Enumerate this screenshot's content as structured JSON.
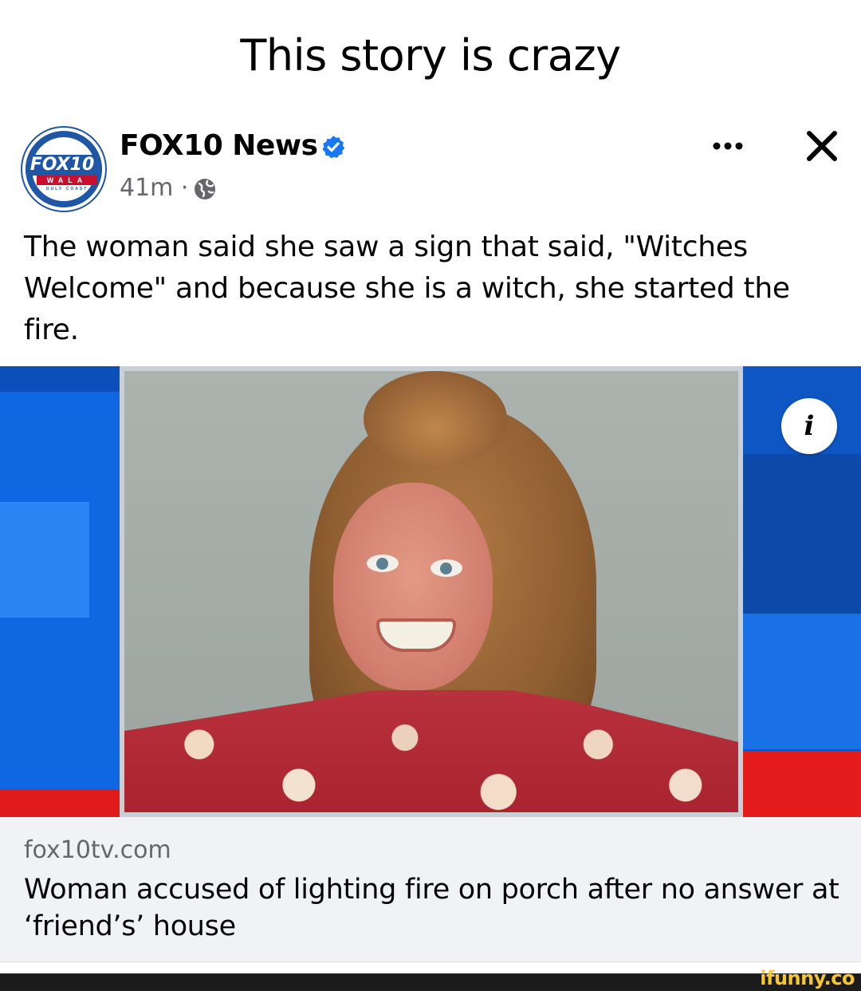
{
  "caption": "This story is crazy",
  "post": {
    "page_name": "FOX10 News",
    "time": "41m ·",
    "text": "The woman said she saw a sign that said, \"Witches Welcome\" and because she is a witch, she started the fire.",
    "avatar": {
      "logo_text": "FOX10",
      "sub_text": "WALA",
      "tag_text": "GULF COAST"
    }
  },
  "icons": {
    "verified": "verified-badge-icon",
    "globe": "globe-icon",
    "more": "more-options-icon",
    "close": "close-icon",
    "info": "info-icon"
  },
  "media": {
    "info_label": "i"
  },
  "link": {
    "domain": "fox10tv.com",
    "title": "Woman accused of lighting fire on porch after no answer at ‘friend’s’ house"
  },
  "watermark": "ifunny.co",
  "colors": {
    "verified": "#1877f2",
    "brand_blue": "#1f56a6",
    "brand_red": "#c8102e",
    "watermark": "#f7c72b"
  }
}
